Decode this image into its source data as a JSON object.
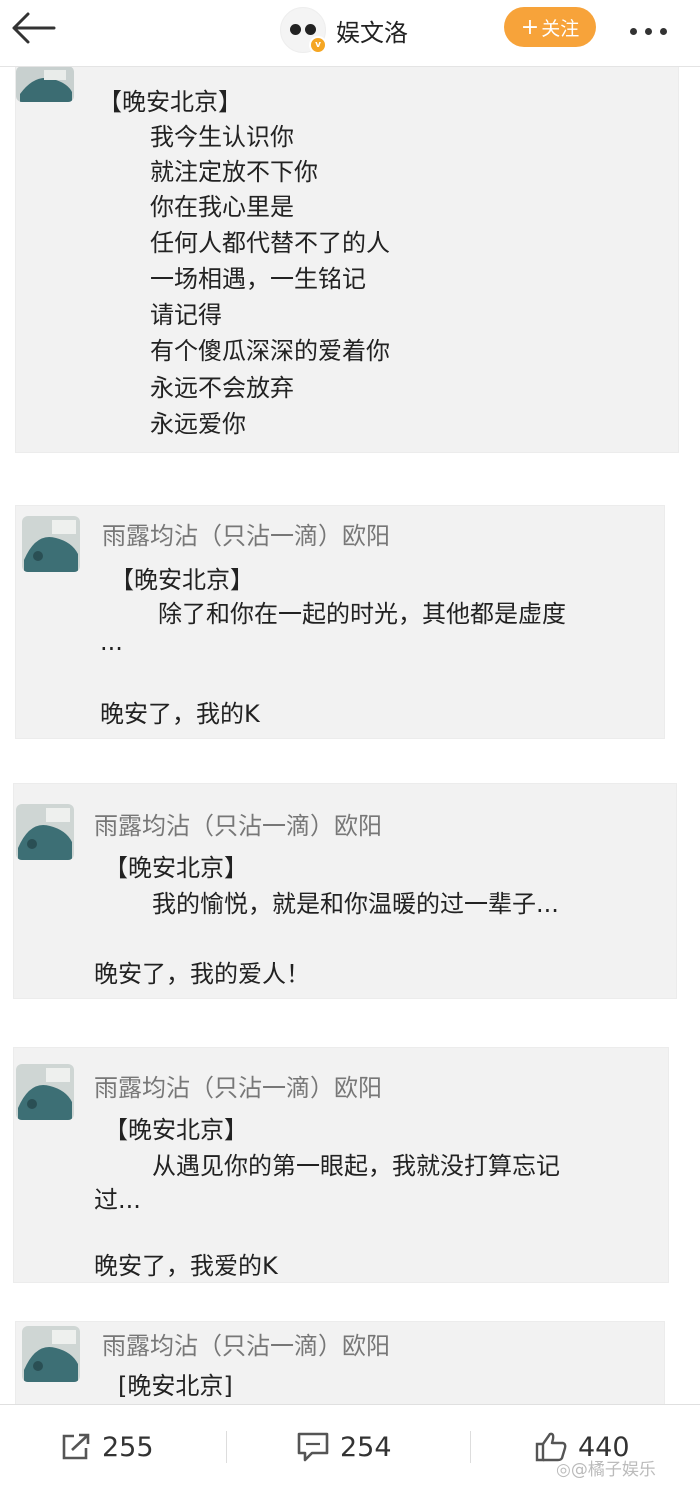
{
  "header": {
    "account_name": "娱文洛",
    "follow_label": "关注",
    "follow_plus": "+",
    "accent_color": "#f7a33a"
  },
  "posts": [
    {
      "nickname": "",
      "lines": [
        "【晚安北京】",
        "我今生认识你",
        "就注定放不下你",
        "你在我心里是",
        "任何人都代替不了的人",
        "一场相遇，一生铭记",
        "请记得",
        "有个傻瓜深深的爱着你",
        "永远不会放弃",
        "永远爱你"
      ]
    },
    {
      "nickname": "雨露均沾（只沾一滴）欧阳",
      "lines": [
        "【晚安北京】",
        "除了和你在一起的时光，其他都是虚度",
        "...",
        "晚安了，我的K"
      ]
    },
    {
      "nickname": "雨露均沾（只沾一滴）欧阳",
      "lines": [
        "【晚安北京】",
        "我的愉悦，就是和你温暖的过一辈子...",
        "晚安了，我的爱人！"
      ]
    },
    {
      "nickname": "雨露均沾（只沾一滴）欧阳",
      "lines": [
        "【晚安北京】",
        "从遇见你的第一眼起，我就没打算忘记",
        "过...",
        "晚安了，我爱的K"
      ]
    },
    {
      "nickname": "雨露均沾（只沾一滴）欧阳",
      "lines": [
        "[晚安北京]"
      ]
    }
  ],
  "actions": {
    "repost_count": "255",
    "comment_count": "254",
    "like_count": "440"
  },
  "watermark": "@橘子娱乐"
}
